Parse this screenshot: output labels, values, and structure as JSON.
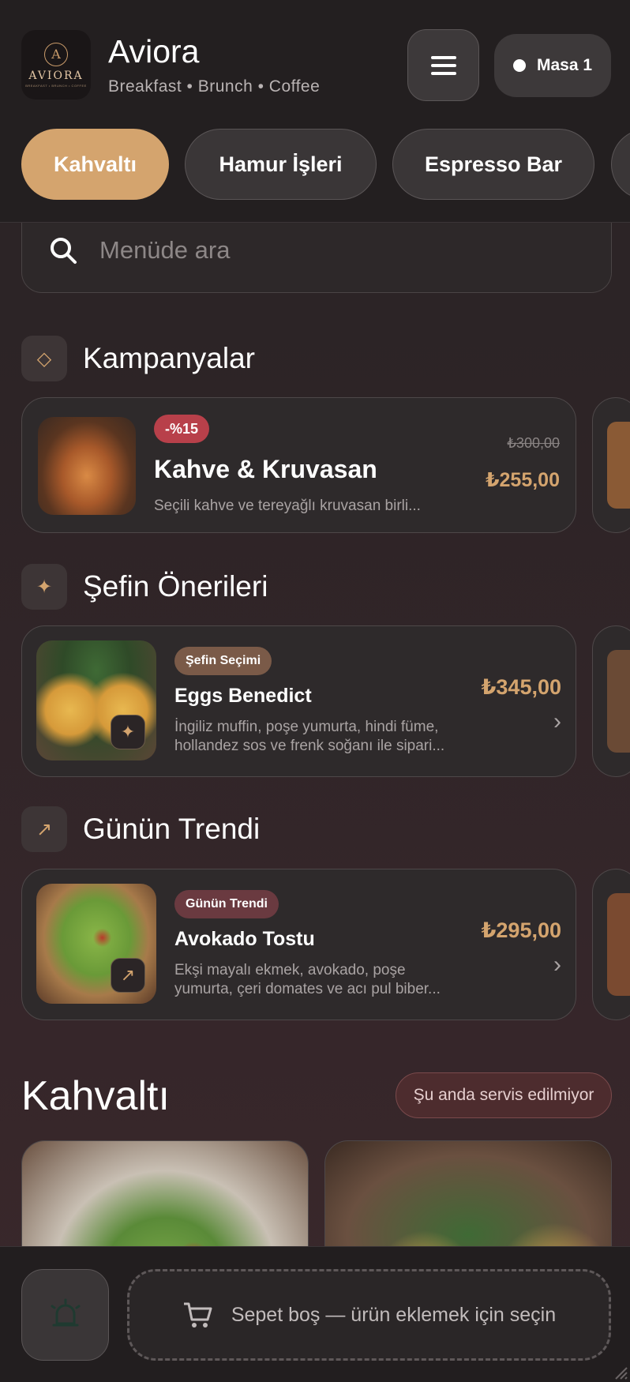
{
  "header": {
    "logo_text": "AVIORA",
    "logo_tagline": "BREAKFAST • BRUNCH • COFFEE",
    "brand_name": "Aviora",
    "brand_tagline": "Breakfast • Brunch • Coffee",
    "table_label": "Masa 1"
  },
  "categories": [
    {
      "label": "Kahvaltı",
      "active": true
    },
    {
      "label": "Hamur İşleri",
      "active": false
    },
    {
      "label": "Espresso Bar",
      "active": false
    }
  ],
  "search": {
    "placeholder": "Menüde ara"
  },
  "sections": {
    "campaigns": {
      "title": "Kampanyalar",
      "icon": "diamond-icon",
      "item": {
        "badge": "-%15",
        "name": "Kahve & Kruvasan",
        "desc": "Seçili kahve ve tereyağlı kruvasan birli...",
        "old_price": "₺300,00",
        "price": "₺255,00"
      }
    },
    "chef": {
      "title": "Şefin Önerileri",
      "icon": "sparkle-icon",
      "item": {
        "badge": "Şefin Seçimi",
        "name": "Eggs Benedict",
        "desc_1": "İngiliz muffin, poşe yumurta, hindi füme,",
        "desc_2": "hollandez sos ve frenk soğanı ile sipari...",
        "price": "₺345,00"
      }
    },
    "trend": {
      "title": "Günün Trendi",
      "icon": "trend-arrow-icon",
      "item": {
        "badge": "Günün Trendi",
        "name": "Avokado Tostu",
        "desc_1": "Ekşi mayalı ekmek, avokado, poşe",
        "desc_2": "yumurta, çeri domates ve acı pul biber...",
        "price": "₺295,00"
      }
    }
  },
  "main_category": {
    "title": "Kahvaltı",
    "status": "Şu anda servis edilmiyor"
  },
  "bottom": {
    "cart_text": "Sepet boş — ürün eklemek için seçin"
  },
  "colors": {
    "accent": "#d4a46e",
    "discount_badge": "#b8404a",
    "chef_badge": "#7a5a48",
    "trend_badge": "#6a3a40"
  }
}
